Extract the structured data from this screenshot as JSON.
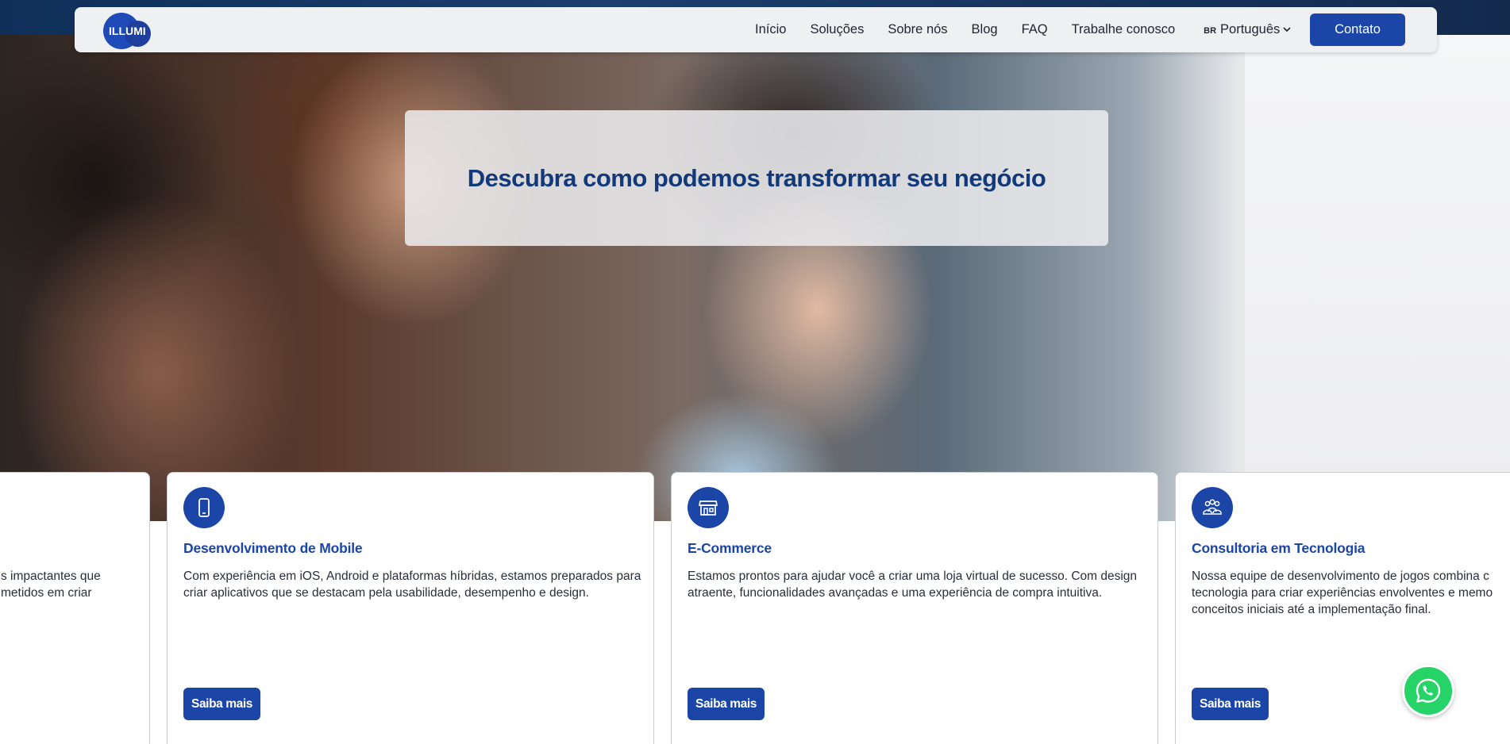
{
  "brand": {
    "logo_text": "ILLUMI"
  },
  "nav": {
    "links": [
      "Início",
      "Soluções",
      "Sobre nós",
      "Blog",
      "FAQ",
      "Trabalhe conosco"
    ],
    "language_flag": "BR",
    "language_label": "Português",
    "contact_label": "Contato"
  },
  "hero": {
    "headline": "Descubra como podemos transformar seu negócio"
  },
  "cards": [
    {
      "title": "",
      "description": "s impactantes que\nmetidos em criar",
      "button": "",
      "icon": "none"
    },
    {
      "title": "Desenvolvimento de Mobile",
      "description": "Com experiência em iOS, Android e plataformas híbridas, estamos preparados para criar aplicativos que se destacam pela usabilidade, desempenho e design.",
      "button": "Saiba mais",
      "icon": "smartphone-icon"
    },
    {
      "title": "E-Commerce",
      "description": "Estamos prontos para ajudar você a criar uma loja virtual de sucesso. Com design atraente, funcionalidades avançadas e uma experiência de compra intuitiva.",
      "button": "Saiba mais",
      "icon": "storefront-icon"
    },
    {
      "title": "Consultoria em Tecnologia",
      "description": "Nossa equipe de desenvolvimento de jogos combina c tecnologia para criar experiências envolventes e memo conceitos iniciais até a implementação final.",
      "button": "Saiba mais",
      "icon": "team-icon"
    }
  ],
  "colors": {
    "primary": "#1c45a8",
    "headline": "#123a7a",
    "whatsapp": "#25d366"
  }
}
